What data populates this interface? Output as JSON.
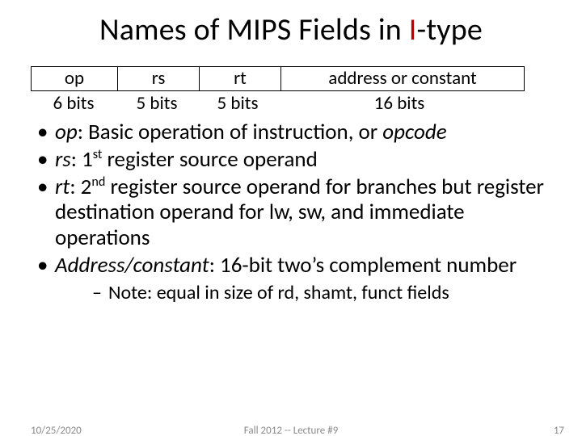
{
  "title": {
    "pre": "Names of MIPS Fields in ",
    "accent": "I",
    "post": "-type"
  },
  "fields": {
    "op": {
      "name": "op",
      "bits": "6 bits"
    },
    "rs": {
      "name": "rs",
      "bits": "5 bits"
    },
    "rt": {
      "name": "rt",
      "bits": "5 bits"
    },
    "addr": {
      "name": "address or constant",
      "bits": "16 bits"
    }
  },
  "bullets": {
    "b1": {
      "term": "op",
      "rest": ": Basic operation of instruction, or ",
      "term2": "opcode"
    },
    "b2": {
      "term": "rs",
      "sup": "st",
      "pre_sup": ": 1",
      "rest": " register source operand"
    },
    "b3": {
      "term": "rt",
      "sup": "nd",
      "pre_sup": ": 2",
      "rest": " register source operand for branches but register destination operand for lw, sw, and immediate operations"
    },
    "b4": {
      "term": "Address/constant",
      "rest": ": 16-bit two’s complement number"
    },
    "note": "Note: equal in size of rd, shamt, funct fields"
  },
  "footer": {
    "date": "10/25/2020",
    "mid": "Fall 2012 -- Lecture #9",
    "num": "17"
  }
}
